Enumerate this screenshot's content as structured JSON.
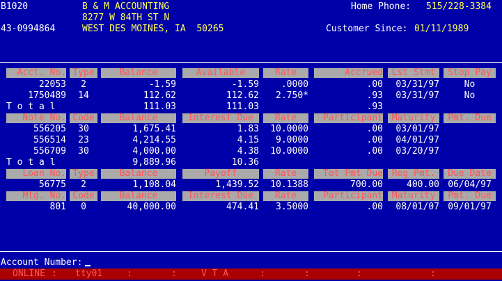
{
  "header": {
    "code": "B1020",
    "name": "B & M ACCOUNTING",
    "address1": "8277 W 84TH ST N",
    "address2": "WEST DES MOINES, IA  50265",
    "tax_id": "43-0994864",
    "home_phone_label": "Home Phone:",
    "home_phone": "515/228-3384",
    "customer_since_label": "Customer Since:",
    "customer_since": "01/11/1989"
  },
  "deposits": {
    "headers": [
      "Acct. No.",
      "Type",
      "Balance",
      "Available",
      "Rate",
      "Accrued",
      "Lst Stmt",
      "Stop Pay"
    ],
    "rows": [
      [
        "22053",
        "2",
        "-1.59",
        "-1.59",
        ".0000",
        ".00",
        "03/31/97",
        "No"
      ],
      [
        "1750489",
        "14",
        "112.62",
        "112.62",
        "2.750*",
        ".93",
        "03/31/97",
        "No"
      ]
    ],
    "total_label": "T o t a l",
    "total_balance": "111.03",
    "total_available": "111.03",
    "total_accrued": ".93"
  },
  "notes": {
    "headers": [
      "Note No.",
      "Code",
      "Balance",
      "Interest Due",
      "Rate",
      "Participant",
      "Maturity",
      "Pmt. Due"
    ],
    "rows": [
      [
        "556205",
        "30",
        "1,675.41",
        "1.83",
        "10.0000",
        ".00",
        "03/01/97",
        ""
      ],
      [
        "556514",
        "23",
        "4,214.55",
        "4.15",
        "9.0000",
        ".00",
        "04/01/97",
        ""
      ],
      [
        "556709",
        "30",
        "4,000.00",
        "4.38",
        "10.0000",
        ".00",
        "03/20/97",
        ""
      ]
    ],
    "total_label": "T o t a l",
    "total_balance": "9,889.96",
    "total_interest": "10.36"
  },
  "loans": {
    "headers": [
      "Loan No.",
      "Type",
      "Balance",
      "Payoff",
      "Rate",
      "Tot Pmt Due",
      "Reg Pmt.",
      "Due Date"
    ],
    "rows": [
      [
        "56775",
        "2",
        "1,108.04",
        "1,439.52",
        "10.1388",
        "700.00",
        "400.00",
        "06/04/97"
      ]
    ]
  },
  "mortgages": {
    "headers": [
      "Mtg. No.",
      "Code",
      "Balance",
      "Interest Due",
      "Rate",
      "Participant",
      "Maturity",
      "Pmt. Due"
    ],
    "rows": [
      [
        "801",
        "0",
        "40,000.00",
        "474.41",
        "3.5000",
        ".00",
        "08/01/07",
        "09/01/97"
      ]
    ]
  },
  "prompt": {
    "label": "Account Number:",
    "value": ""
  },
  "status_bar": {
    "online": "ONLINE",
    "terminal": "tty01",
    "mode": "V T A"
  },
  "colors": {
    "background": "#0000a8",
    "header_cell": "#aaaaaa",
    "header_text": "#ff5555",
    "value_text": "#ffffff",
    "bank_text": "#ffff55",
    "status_bar": "#aa0000"
  }
}
